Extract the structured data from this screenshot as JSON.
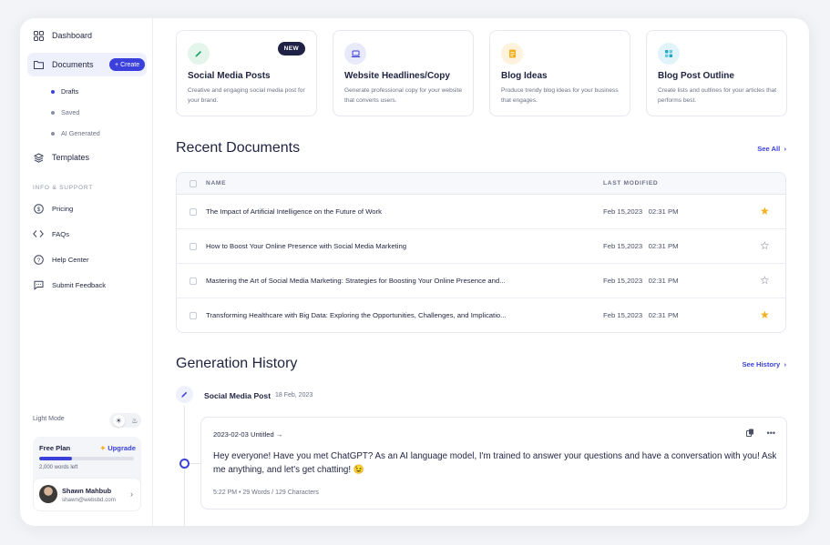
{
  "sidebar": {
    "dashboard": "Dashboard",
    "documents": "Documents",
    "create_label": "Create",
    "sub_items": [
      "Drafts",
      "Saved",
      "AI Generated"
    ],
    "templates": "Templates",
    "section_label": "INFO & SUPPORT",
    "support_items": [
      "Pricing",
      "FAQs",
      "Help Center",
      "Submit Feedback"
    ],
    "light_mode_label": "Light Mode",
    "plan": {
      "title": "Free Plan",
      "upgrade": "Upgrade",
      "words_left": "2,000 words left",
      "usage_fraction": 0.35
    },
    "user": {
      "name": "Shawn Mahbub",
      "email": "shawn@websbd.com"
    }
  },
  "cards": [
    {
      "title": "Social Media Posts",
      "desc": "Creative and engaging social media post for your brand.",
      "badge": "NEW",
      "icon": "pencil-icon",
      "color": "#20a36b"
    },
    {
      "title": "Website Headlines/Copy",
      "desc": "Generate professional copy for your website that converts users.",
      "icon": "laptop-icon",
      "color": "#3a40d9"
    },
    {
      "title": "Blog Ideas",
      "desc": "Produce trendy blog ideas for your business that engages.",
      "icon": "document-icon",
      "color": "#f2b01e"
    },
    {
      "title": "Blog Post Outline",
      "desc": "Create lists and outlines for your articles that performs best.",
      "icon": "grid-icon",
      "color": "#20a6c9"
    }
  ],
  "recent": {
    "heading": "Recent Documents",
    "see_all": "See All",
    "columns": [
      "NAME",
      "LAST MODIFIED"
    ],
    "rows": [
      {
        "name": "The Impact of Artificial Intelligence on the Future of Work",
        "date": "Feb 15,2023",
        "time": "02:31 PM",
        "starred": true
      },
      {
        "name": "How to Boost Your Online Presence with Social Media Marketing",
        "date": "Feb 15,2023",
        "time": "02:31 PM",
        "starred": false
      },
      {
        "name": "Mastering the Art of Social Media Marketing: Strategies for Boosting Your Online Presence and...",
        "date": "Feb 15,2023",
        "time": "02:31 PM",
        "starred": false
      },
      {
        "name": "Transforming Healthcare with Big Data: Exploring the Opportunities, Challenges, and Implicatio...",
        "date": "Feb 15,2023",
        "time": "02:31 PM",
        "starred": true
      }
    ]
  },
  "history": {
    "heading": "Generation History",
    "see_history": "See History",
    "entry_title": "Social Media Post",
    "entry_date": "18 Feb, 2023",
    "card_head": "2023-02-03 Untitled →",
    "text": "Hey everyone! Have you met ChatGPT? As an AI language model, I'm trained to answer your questions and have a conversation with you! Ask me anything, and let's get chatting! 😉",
    "meta": "5:22 PM  •  29 Words / 129 Characters"
  }
}
